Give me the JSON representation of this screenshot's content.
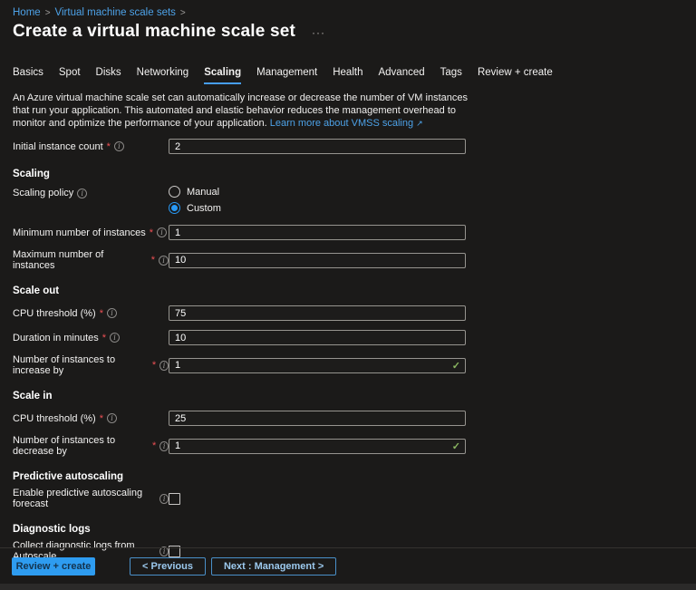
{
  "breadcrumb": {
    "items": [
      "Home",
      "Virtual machine scale sets"
    ],
    "separator": ">"
  },
  "page": {
    "title": "Create a virtual machine scale set",
    "more_label": "···"
  },
  "tabs": {
    "items": [
      "Basics",
      "Spot",
      "Disks",
      "Networking",
      "Scaling",
      "Management",
      "Health",
      "Advanced",
      "Tags",
      "Review + create"
    ],
    "selected": "Scaling"
  },
  "intro": {
    "text": "An Azure virtual machine scale set can automatically increase or decrease the number of VM instances that run your application. This automated and elastic behavior reduces the management overhead to monitor and optimize the performance of your application.",
    "link_label": "Learn more about VMSS scaling",
    "external_icon": "↗"
  },
  "form": {
    "info_icon_glyph": "i",
    "required_mark": "*",
    "initial_instance_count": {
      "label": "Initial instance count",
      "value": "2"
    },
    "scaling": {
      "title": "Scaling",
      "policy": {
        "label": "Scaling policy",
        "options": [
          "Manual",
          "Custom"
        ],
        "selected": "Custom"
      },
      "min_instances": {
        "label": "Minimum number of instances",
        "value": "1"
      },
      "max_instances": {
        "label": "Maximum number of instances",
        "value": "10"
      }
    },
    "scale_out": {
      "title": "Scale out",
      "cpu_threshold": {
        "label": "CPU threshold (%)",
        "value": "75"
      },
      "duration": {
        "label": "Duration in minutes",
        "value": "10"
      },
      "increase_by": {
        "label": "Number of instances to increase by",
        "value": "1",
        "valid_icon": "✓"
      }
    },
    "scale_in": {
      "title": "Scale in",
      "cpu_threshold": {
        "label": "CPU threshold (%)",
        "value": "25"
      },
      "decrease_by": {
        "label": "Number of instances to decrease by",
        "value": "1",
        "valid_icon": "✓"
      }
    },
    "predictive": {
      "title": "Predictive autoscaling",
      "checkbox_label": "Enable predictive autoscaling forecast",
      "checked": false
    },
    "diagnostic": {
      "title": "Diagnostic logs",
      "checkbox_label": "Collect diagnostic logs from Autoscale",
      "checked": false
    }
  },
  "footer": {
    "review_create_label": "Review + create",
    "previous_label": "< Previous",
    "next_label": "Next : Management >"
  },
  "colors": {
    "background": "#1b1a19",
    "link_blue": "#4da2e8",
    "accent_blue": "#2899f5",
    "tab_underline": "#479ef5",
    "required_red": "#ee5055",
    "success_green": "#8ab661",
    "primary_button_bg": "#2e9cf0",
    "primary_button_text": "#14344f"
  }
}
